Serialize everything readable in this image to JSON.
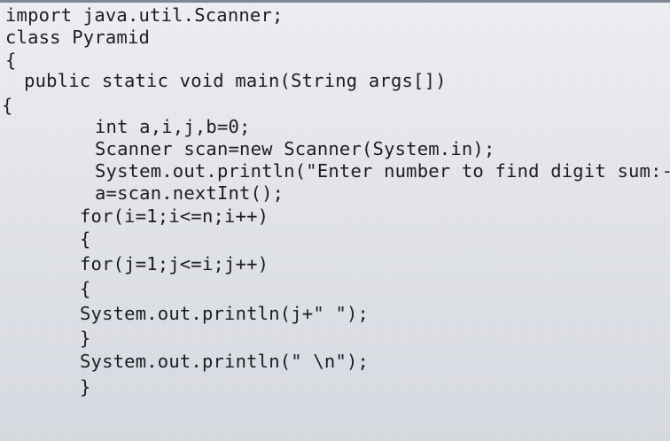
{
  "editor": {
    "lines": [
      "import java.util.Scanner;",
      "class Pyramid",
      "{",
      "  public static void main(String args[])",
      "{",
      "int a,i,j,b=0;",
      "Scanner scan=new Scanner(System.in);",
      "System.out.println(\"Enter number to find digit sum:-\");",
      "a=scan.nextInt();",
      "for(i=1;i<=n;i++)",
      "{",
      "for(j=1;j<=i;j++)",
      "{",
      "System.out.println(j+\" \");",
      "}",
      "System.out.println(\" \\n\");",
      "}"
    ]
  }
}
